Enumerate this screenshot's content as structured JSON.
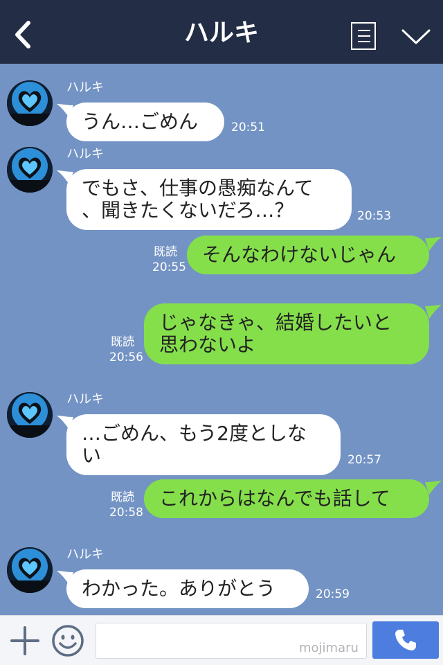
{
  "header": {
    "title": "ハルキ"
  },
  "messages": [
    {
      "direction": "in",
      "sender": "ハルキ",
      "text": "うん…ごめん",
      "time": "20:51"
    },
    {
      "direction": "in",
      "sender": "ハルキ",
      "text": "でもさ、仕事の愚痴なんて\n、聞きたくないだろ…？",
      "time": "20:53"
    },
    {
      "direction": "out",
      "read": "既読",
      "text": "そんなわけないじゃん",
      "time": "20:55"
    },
    {
      "direction": "out",
      "read": "既読",
      "text": "じゃなきゃ、結婚したいと\n思わないよ",
      "time": "20:56"
    },
    {
      "direction": "in",
      "sender": "ハルキ",
      "text": "…ごめん、もう2度としな\nい",
      "time": "20:57"
    },
    {
      "direction": "out",
      "read": "既読",
      "text": "これからはなんでも話して",
      "time": "20:58"
    },
    {
      "direction": "in",
      "sender": "ハルキ",
      "text": "わかった。ありがとう",
      "time": "20:59"
    }
  ],
  "input": {
    "placeholder": "",
    "watermark": "mojimaru"
  },
  "colors": {
    "header_bg": "#232d45",
    "chat_bg": "#7393c4",
    "bubble_in": "#ffffff",
    "bubble_out": "#85df4b",
    "call_button": "#4e7de0"
  },
  "icons": {
    "back": "chevron-left-icon",
    "menu": "list-icon",
    "collapse": "chevron-down-icon",
    "plus": "plus-icon",
    "emoji": "smile-icon",
    "call": "phone-icon"
  }
}
